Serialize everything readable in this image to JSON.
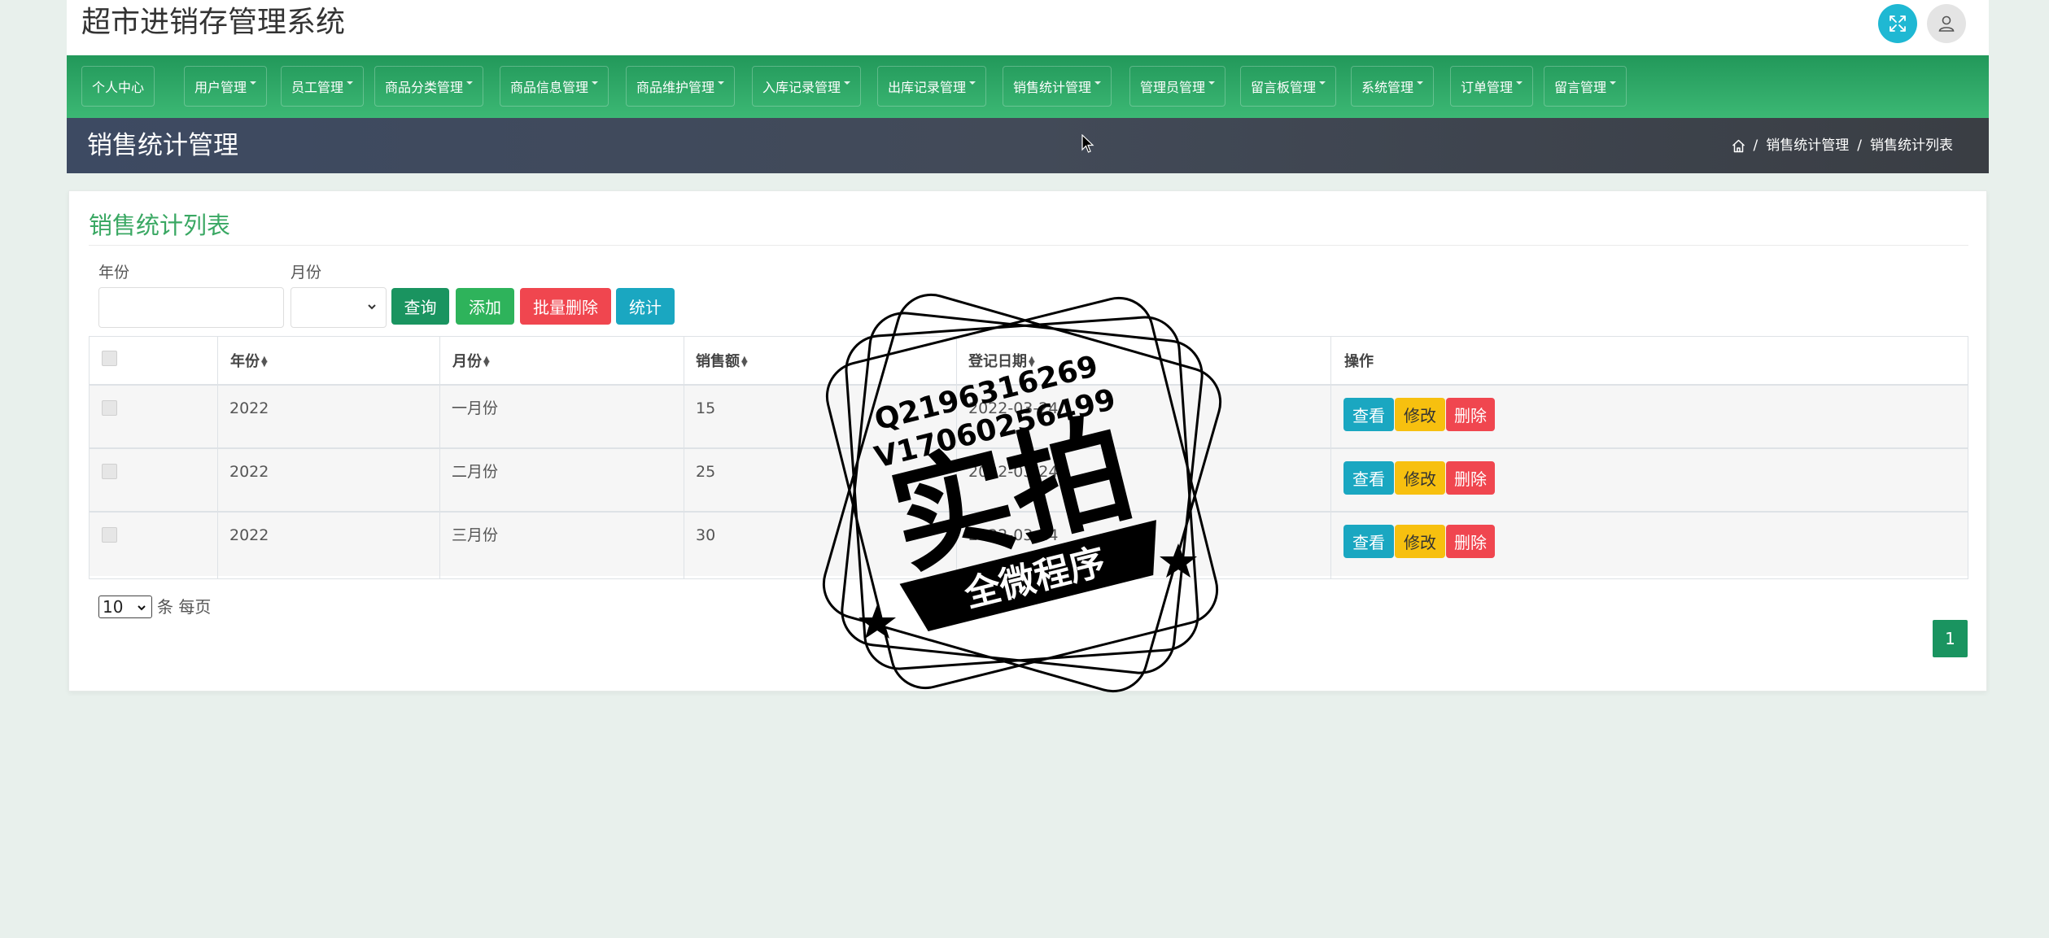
{
  "app": {
    "title": "超市进销存管理系统"
  },
  "header": {
    "fullscreen_icon": "expand-arrows-icon",
    "user_icon": "user-icon",
    "fullscreen_color": "#1fb8d3"
  },
  "nav": {
    "items": [
      {
        "label": "个人中心",
        "dropdown": false
      },
      {
        "label": "用户管理",
        "dropdown": true
      },
      {
        "label": "员工管理",
        "dropdown": true
      },
      {
        "label": "商品分类管理",
        "dropdown": true
      },
      {
        "label": "商品信息管理",
        "dropdown": true
      },
      {
        "label": "商品维护管理",
        "dropdown": true
      },
      {
        "label": "入库记录管理",
        "dropdown": true
      },
      {
        "label": "出库记录管理",
        "dropdown": true
      },
      {
        "label": "销售统计管理",
        "dropdown": true
      },
      {
        "label": "管理员管理",
        "dropdown": true
      },
      {
        "label": "留言板管理",
        "dropdown": true
      },
      {
        "label": "系统管理",
        "dropdown": true
      },
      {
        "label": "订单管理",
        "dropdown": true
      },
      {
        "label": "留言管理",
        "dropdown": true
      }
    ],
    "color": "#2ea865"
  },
  "page": {
    "title": "销售统计管理",
    "breadcrumb": [
      "销售统计管理",
      "销售统计列表"
    ]
  },
  "list": {
    "title": "销售统计列表",
    "filters": {
      "year_label": "年份",
      "year_value": "",
      "month_label": "月份",
      "month_value": ""
    },
    "buttons": {
      "query": "查询",
      "add": "添加",
      "bulk_delete": "批量删除",
      "stats": "统计"
    },
    "columns": [
      "年份",
      "月份",
      "销售额",
      "登记日期",
      "操作"
    ],
    "rows": [
      {
        "year": "2022",
        "month": "一月份",
        "sales": "15",
        "date": "2022-03-24"
      },
      {
        "year": "2022",
        "month": "二月份",
        "sales": "25",
        "date": "2022-03-24"
      },
      {
        "year": "2022",
        "month": "三月份",
        "sales": "30",
        "date": "2022-03-24"
      }
    ],
    "row_actions": {
      "view": "查看",
      "edit": "修改",
      "delete": "删除"
    },
    "pagination": {
      "page_size": "10",
      "per_page_text": "条 每页",
      "current_page": "1"
    }
  },
  "watermark": {
    "line1": "Q2196316269",
    "line2": "V17060256499",
    "big": "实拍",
    "banner": "全微程序"
  }
}
